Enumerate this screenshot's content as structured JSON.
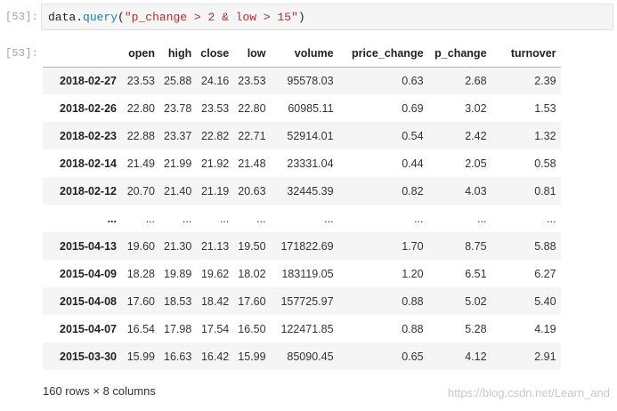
{
  "cell": {
    "input_prompt": "[53]:",
    "output_prompt": "[53]:",
    "code": {
      "obj": "data",
      "dot": ".",
      "method": "query",
      "open_paren": "(",
      "query_string": "\"p_change > 2 & low > 15\"",
      "close_paren": ")"
    }
  },
  "table": {
    "columns": [
      "",
      "open",
      "high",
      "close",
      "low",
      "volume",
      "price_change",
      "p_change",
      "turnover"
    ],
    "rows": [
      [
        "2018-02-27",
        "23.53",
        "25.88",
        "24.16",
        "23.53",
        "95578.03",
        "0.63",
        "2.68",
        "2.39"
      ],
      [
        "2018-02-26",
        "22.80",
        "23.78",
        "23.53",
        "22.80",
        "60985.11",
        "0.69",
        "3.02",
        "1.53"
      ],
      [
        "2018-02-23",
        "22.88",
        "23.37",
        "22.82",
        "22.71",
        "52914.01",
        "0.54",
        "2.42",
        "1.32"
      ],
      [
        "2018-02-14",
        "21.49",
        "21.99",
        "21.92",
        "21.48",
        "23331.04",
        "0.44",
        "2.05",
        "0.58"
      ],
      [
        "2018-02-12",
        "20.70",
        "21.40",
        "21.19",
        "20.63",
        "32445.39",
        "0.82",
        "4.03",
        "0.81"
      ],
      [
        "...",
        "...",
        "...",
        "...",
        "...",
        "...",
        "...",
        "...",
        "..."
      ],
      [
        "2015-04-13",
        "19.60",
        "21.30",
        "21.13",
        "19.50",
        "171822.69",
        "1.70",
        "8.75",
        "5.88"
      ],
      [
        "2015-04-09",
        "18.28",
        "19.89",
        "19.62",
        "18.02",
        "183119.05",
        "1.20",
        "6.51",
        "6.27"
      ],
      [
        "2015-04-08",
        "17.60",
        "18.53",
        "18.42",
        "17.60",
        "157725.97",
        "0.88",
        "5.02",
        "5.40"
      ],
      [
        "2015-04-07",
        "16.54",
        "17.98",
        "17.54",
        "16.50",
        "122471.85",
        "0.88",
        "5.28",
        "4.19"
      ],
      [
        "2015-03-30",
        "15.99",
        "16.63",
        "16.42",
        "15.99",
        "85090.45",
        "0.65",
        "4.12",
        "2.91"
      ]
    ]
  },
  "summary": "160 rows × 8 columns",
  "watermark": "https://blog.csdn.net/Learn_and",
  "colors": {
    "prompt": "#9aa2aa",
    "code_method": "#1a7fa5",
    "code_string": "#b92a2a",
    "stripe": "#f5f5f5"
  }
}
